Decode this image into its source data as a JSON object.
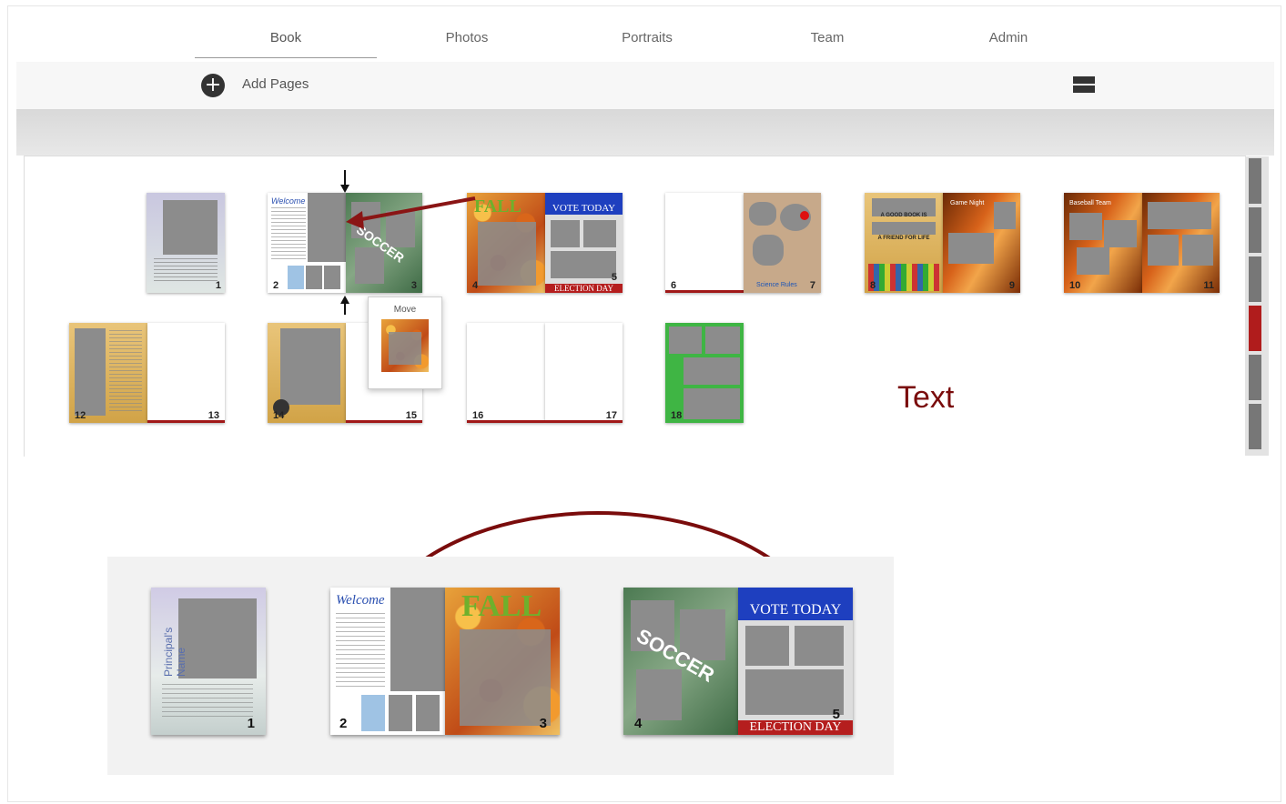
{
  "nav": {
    "tabs": [
      {
        "label": "Book",
        "active": true
      },
      {
        "label": "Photos",
        "active": false
      },
      {
        "label": "Portraits",
        "active": false
      },
      {
        "label": "Team",
        "active": false
      },
      {
        "label": "Admin",
        "active": false
      }
    ]
  },
  "toolbar": {
    "add_icon": "plus-circle-icon",
    "add_label": "Add Pages",
    "view_icon": "grid-view-icon"
  },
  "pages": {
    "p1": "1",
    "p2": "2",
    "p3": "3",
    "p4": "4",
    "p5": "5",
    "p6": "6",
    "p7": "7",
    "p8": "8",
    "p9": "9",
    "p10": "10",
    "p11": "11",
    "p12": "12",
    "p13": "13",
    "p14": "14",
    "p15": "15",
    "p16": "16",
    "p17": "17",
    "p18": "18"
  },
  "page_texts": {
    "principal": "Principal's Name",
    "welcome": "Welcome",
    "fall": "FALL",
    "vote_today": "VOTE TODAY",
    "election_day": "ELECTION DAY",
    "soccer": "SOCCER",
    "good_book": "A GOOD BOOK IS",
    "friend": "A FRIEND FOR LIFE",
    "game_night": "Game Night",
    "baseball": "Baseball Team",
    "science": "Science Rules"
  },
  "move_popup": {
    "label": "Move"
  },
  "annotation_text": "Text",
  "colors": {
    "accent_red": "#a01818",
    "annotation": "#7a0c0c",
    "vote_blue": "#1e3fbf"
  }
}
